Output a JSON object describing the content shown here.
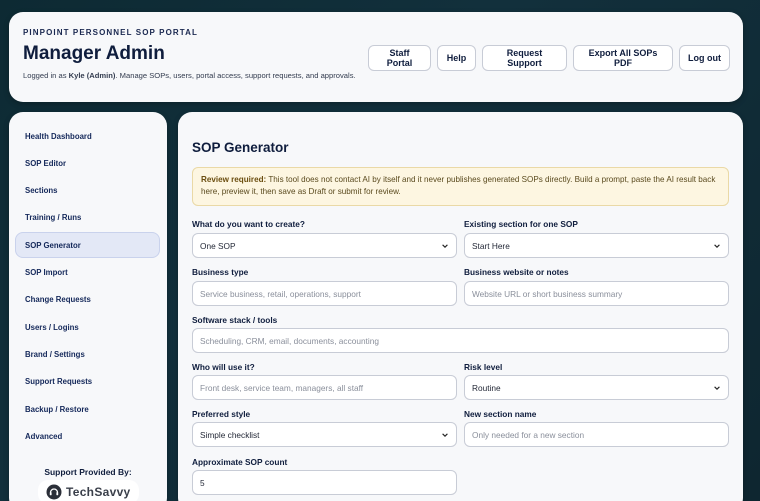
{
  "header": {
    "portal_tag": "PINPOINT PERSONNEL SOP PORTAL",
    "title": "Manager Admin",
    "subtitle_prefix": "Logged in as ",
    "user": "Kyle (Admin)",
    "subtitle_suffix": ". Manage SOPs, users, portal access, support requests, and approvals.",
    "buttons": [
      "Staff Portal",
      "Help",
      "Request Support",
      "Export All SOPs PDF",
      "Log out"
    ]
  },
  "sidebar": {
    "items": [
      {
        "label": "Health Dashboard",
        "active": false
      },
      {
        "label": "SOP Editor",
        "active": false
      },
      {
        "label": "Sections",
        "active": false
      },
      {
        "label": "Training / Runs",
        "active": false
      },
      {
        "label": "SOP Generator",
        "active": true
      },
      {
        "label": "SOP Import",
        "active": false
      },
      {
        "label": "Change Requests",
        "active": false
      },
      {
        "label": "Users / Logins",
        "active": false
      },
      {
        "label": "Brand / Settings",
        "active": false
      },
      {
        "label": "Support Requests",
        "active": false
      },
      {
        "label": "Backup / Restore",
        "active": false
      },
      {
        "label": "Advanced",
        "active": false
      }
    ],
    "support_label": "Support Provided By:",
    "brand_name": "TechSavvy"
  },
  "main": {
    "title": "SOP Generator",
    "notice": {
      "strong": "Review required:",
      "text": " This tool does not contact AI by itself and it never publishes generated SOPs directly. Build a prompt, paste the AI result back here, preview it, then save as Draft or submit for review."
    },
    "fields": {
      "create": {
        "label": "What do you want to create?",
        "value": "One SOP"
      },
      "section": {
        "label": "Existing section for one SOP",
        "value": "Start Here"
      },
      "business_type": {
        "label": "Business type",
        "placeholder": "Service business, retail, operations, support"
      },
      "website": {
        "label": "Business website or notes",
        "placeholder": "Website URL or short business summary"
      },
      "software": {
        "label": "Software stack / tools",
        "placeholder": "Scheduling, CRM, email, documents, accounting"
      },
      "audience": {
        "label": "Who will use it?",
        "placeholder": "Front desk, service team, managers, all staff"
      },
      "risk": {
        "label": "Risk level",
        "value": "Routine"
      },
      "style": {
        "label": "Preferred style",
        "value": "Simple checklist"
      },
      "new_section": {
        "label": "New section name",
        "placeholder": "Only needed for a new section"
      },
      "count": {
        "label": "Approximate SOP count",
        "value": "5"
      }
    }
  },
  "colors": {
    "navy": "#0f1d3d",
    "notice_bg": "#fdf6e1",
    "active_nav_bg": "#e3e8f6"
  }
}
